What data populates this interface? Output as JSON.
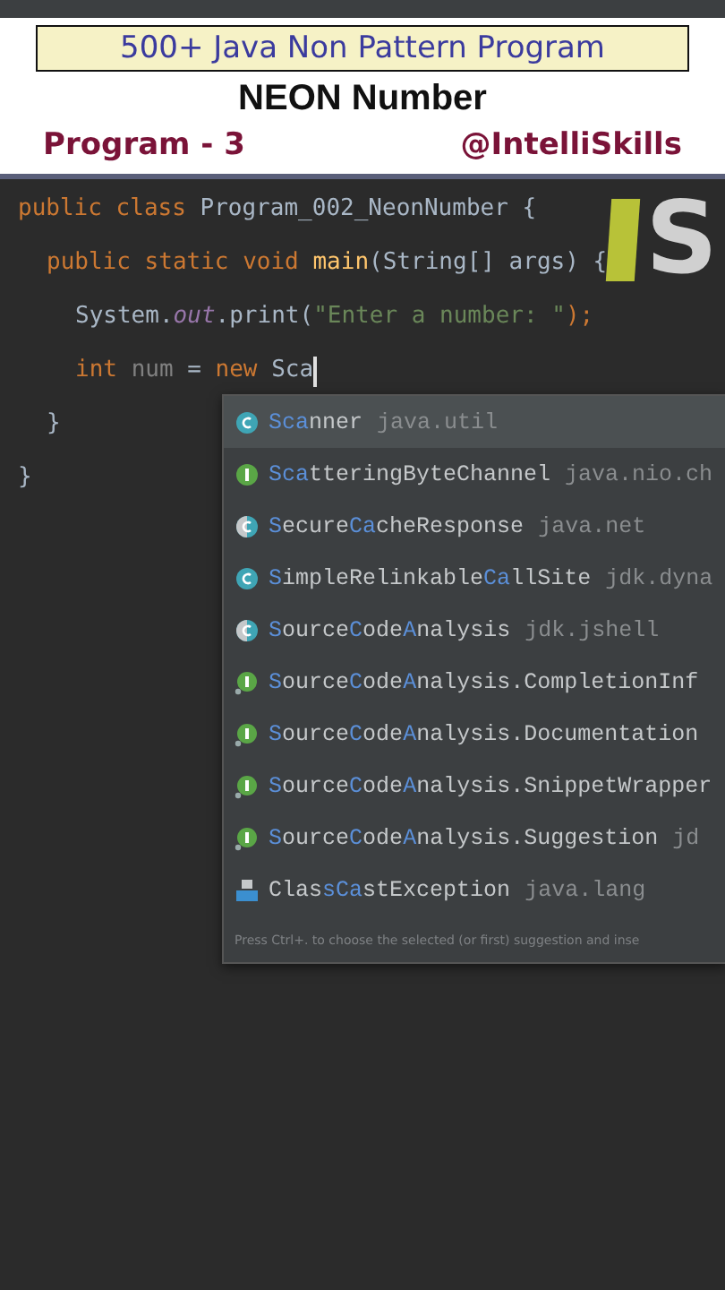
{
  "banner": {
    "series_title": "500+ Java Non Pattern Program",
    "topic": "NEON Number",
    "program_label": "Program - 3",
    "channel": "@IntelliSkills"
  },
  "logo": {
    "letter": "S"
  },
  "code": [
    {
      "tokens": [
        {
          "t": "public class ",
          "kind": "keyword"
        },
        {
          "t": "Program_002_NeonNumber {",
          "kind": "plain"
        }
      ],
      "children": [
        {
          "tokens": [
            {
              "t": "public static void ",
              "kind": "keyword"
            },
            {
              "t": "main",
              "kind": "method"
            },
            {
              "t": "(String[] args) {",
              "kind": "plain"
            }
          ],
          "children": [
            {
              "tokens": [
                {
                  "t": "System.",
                  "kind": "plain"
                },
                {
                  "t": "out",
                  "kind": "field"
                },
                {
                  "t": ".print(",
                  "kind": "plain"
                },
                {
                  "t": "\"Enter a number: \"",
                  "kind": "string"
                },
                {
                  "t": ");",
                  "kind": "keyword"
                }
              ]
            },
            {
              "caret": true,
              "tokens": [
                {
                  "t": "int ",
                  "kind": "keyword"
                },
                {
                  "t": "num",
                  "kind": "unused"
                },
                {
                  "t": " = ",
                  "kind": "plain"
                },
                {
                  "t": "new ",
                  "kind": "keyword"
                },
                {
                  "t": "Sca",
                  "kind": "plain"
                }
              ]
            }
          ]
        },
        {
          "tokens": [
            {
              "t": "}",
              "kind": "plain"
            }
          ]
        }
      ]
    },
    {
      "tokens": [
        {
          "t": "}",
          "kind": "plain"
        }
      ]
    }
  ],
  "completion": {
    "items": [
      {
        "kind": "class",
        "selected": true,
        "name": [
          {
            "text": "Sca",
            "match": true
          },
          {
            "text": "nner",
            "match": false
          }
        ],
        "package": "java.util"
      },
      {
        "kind": "interface",
        "selected": false,
        "name": [
          {
            "text": "Sca",
            "match": true
          },
          {
            "text": "tteringByteChannel",
            "match": false
          }
        ],
        "package": "java.nio.ch"
      },
      {
        "kind": "abstract",
        "selected": false,
        "name": [
          {
            "text": "S",
            "match": true
          },
          {
            "text": "ecure",
            "match": false
          },
          {
            "text": "Ca",
            "match": true
          },
          {
            "text": "cheResponse",
            "match": false
          }
        ],
        "package": "java.net"
      },
      {
        "kind": "class",
        "selected": false,
        "name": [
          {
            "text": "S",
            "match": true
          },
          {
            "text": "impleRelinkable",
            "match": false
          },
          {
            "text": "Ca",
            "match": true
          },
          {
            "text": "llSite",
            "match": false
          }
        ],
        "package": "jdk.dyna"
      },
      {
        "kind": "abstract",
        "selected": false,
        "name": [
          {
            "text": "S",
            "match": true
          },
          {
            "text": "ource",
            "match": false
          },
          {
            "text": "C",
            "match": true
          },
          {
            "text": "ode",
            "match": false
          },
          {
            "text": "A",
            "match": true
          },
          {
            "text": "nalysis",
            "match": false
          }
        ],
        "package": "jdk.jshell"
      },
      {
        "kind": "nested_interface",
        "selected": false,
        "name": [
          {
            "text": "S",
            "match": true
          },
          {
            "text": "ource",
            "match": false
          },
          {
            "text": "C",
            "match": true
          },
          {
            "text": "ode",
            "match": false
          },
          {
            "text": "A",
            "match": true
          },
          {
            "text": "nalysis.CompletionInf",
            "match": false
          }
        ]
      },
      {
        "kind": "nested_interface",
        "selected": false,
        "name": [
          {
            "text": "S",
            "match": true
          },
          {
            "text": "ource",
            "match": false
          },
          {
            "text": "C",
            "match": true
          },
          {
            "text": "ode",
            "match": false
          },
          {
            "text": "A",
            "match": true
          },
          {
            "text": "nalysis.Documentation",
            "match": false
          }
        ]
      },
      {
        "kind": "nested_interface",
        "selected": false,
        "name": [
          {
            "text": "S",
            "match": true
          },
          {
            "text": "ource",
            "match": false
          },
          {
            "text": "C",
            "match": true
          },
          {
            "text": "ode",
            "match": false
          },
          {
            "text": "A",
            "match": true
          },
          {
            "text": "nalysis.SnippetWrapper",
            "match": false
          }
        ]
      },
      {
        "kind": "nested_interface",
        "selected": false,
        "name": [
          {
            "text": "S",
            "match": true
          },
          {
            "text": "ource",
            "match": false
          },
          {
            "text": "C",
            "match": true
          },
          {
            "text": "ode",
            "match": false
          },
          {
            "text": "A",
            "match": true
          },
          {
            "text": "nalysis.Suggestion",
            "match": false
          }
        ],
        "package": "jd"
      },
      {
        "kind": "exception",
        "selected": false,
        "name": [
          {
            "text": "Clas",
            "match": false
          },
          {
            "text": "s",
            "match": true
          },
          {
            "text": "Ca",
            "match": true
          },
          {
            "text": "stException",
            "match": false
          }
        ],
        "package": "java.lang"
      }
    ],
    "hint": "Press Ctrl+. to choose the selected (or first) suggestion and inse"
  }
}
